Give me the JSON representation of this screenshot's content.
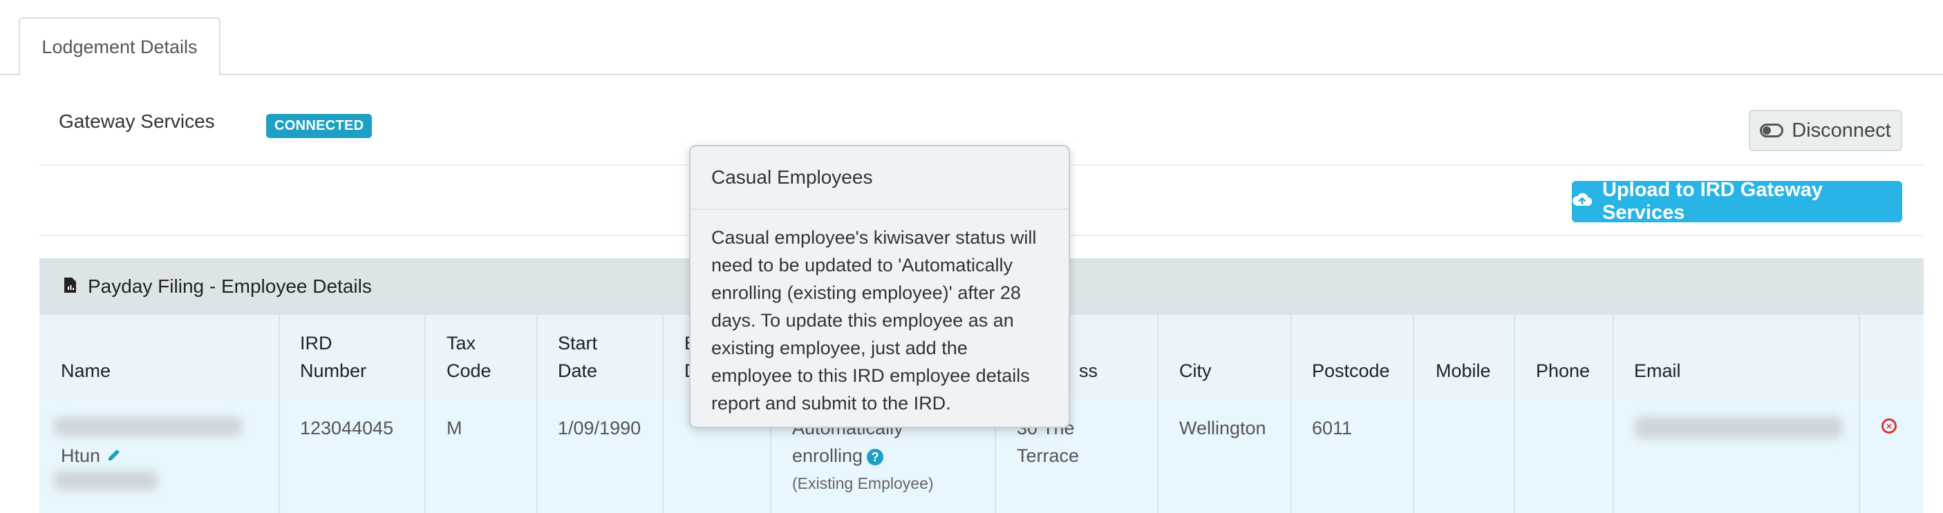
{
  "tabs": {
    "active_label": "Lodgement Details"
  },
  "gateway": {
    "label": "Gateway Services",
    "status_badge": "CONNECTED",
    "disconnect_label": "Disconnect",
    "upload_label": "Upload to IRD Gateway Services"
  },
  "panel": {
    "title": "Payday Filing - Employee Details"
  },
  "table": {
    "headers": {
      "name": "Name",
      "ird_line1": "IRD",
      "ird_line2": "Number",
      "tax_line1": "Tax",
      "tax_line2": "Code",
      "start_line1": "Start",
      "start_line2": "Date",
      "end_line1": "E",
      "end_line2": "D",
      "address_partial": "ss",
      "city": "City",
      "postcode": "Postcode",
      "mobile": "Mobile",
      "phone": "Phone",
      "email": "Email"
    },
    "rows": [
      {
        "name_visible": "Htun",
        "ird": "123044045",
        "tax_code": "M",
        "start_date": "1/09/1990",
        "kiwisaver_line1": "Automatically",
        "kiwisaver_line2": "enrolling",
        "kiwisaver_sub": "(Existing Employee)",
        "address_line1": "30 The",
        "address_line2": "Terrace",
        "city": "Wellington",
        "postcode": "6011"
      }
    ]
  },
  "popover": {
    "title": "Casual Employees",
    "body": "Casual employee's kiwisaver status will need to be updated to 'Automatically enrolling (existing employee)' after 28 days. To update this employee as an existing employee, just add the employee to this IRD employee details report and submit to the IRD."
  },
  "colors": {
    "badge": "#1ea0c4",
    "upload_button": "#29b4e6",
    "panel_header": "#dde4e7",
    "row_highlight": "#e8f6fd",
    "delete": "#d9343f"
  },
  "icons": {
    "disconnect": "toggle-icon",
    "upload": "cloud-upload-icon",
    "panel": "report-file-icon",
    "edit": "pencil-icon",
    "help": "question-icon",
    "delete": "remove-circle-icon"
  }
}
